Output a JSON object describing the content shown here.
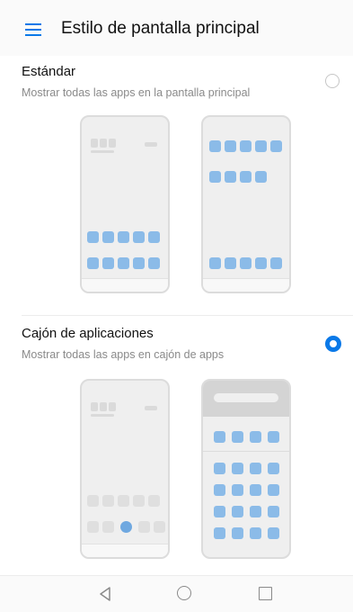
{
  "header": {
    "title": "Estilo de pantalla principal"
  },
  "options": [
    {
      "title": "Estándar",
      "description": "Mostrar todas las apps en la pantalla principal",
      "selected": false
    },
    {
      "title": "Cajón de aplicaciones",
      "description": "Mostrar todas las apps en cajón de apps",
      "selected": true
    }
  ],
  "colors": {
    "accent": "#0a79e8",
    "tile": "#8bbbe8"
  },
  "icons": {
    "menu": "hamburger-menu-icon",
    "back": "back-triangle-icon",
    "home": "home-circle-icon",
    "recent": "recent-square-icon"
  }
}
